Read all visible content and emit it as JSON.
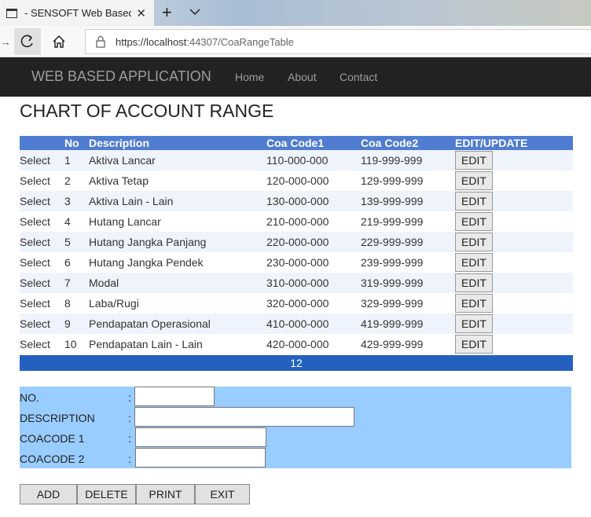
{
  "browser": {
    "tab_title": "- SENSOFT Web Based A",
    "tab_close": "✕",
    "new_tab": "+",
    "url_host": "https://localhost",
    "url_rest": ":44307/CoaRangeTable"
  },
  "navbar": {
    "brand": "WEB BASED APPLICATION",
    "links": [
      "Home",
      "About",
      "Contact"
    ]
  },
  "page": {
    "title": "CHART OF ACCOUNT RANGE"
  },
  "table": {
    "headers": [
      "",
      "No",
      "Description",
      "Coa Code1",
      "Coa Code2",
      "EDIT/UPDATE"
    ],
    "rows": [
      {
        "select": "Select",
        "no": "1",
        "description": "Aktiva Lancar",
        "code1": "110-000-000",
        "code2": "119-999-999",
        "edit": "EDIT"
      },
      {
        "select": "Select",
        "no": "2",
        "description": "Aktiva Tetap",
        "code1": "120-000-000",
        "code2": "129-999-999",
        "edit": "EDIT"
      },
      {
        "select": "Select",
        "no": "3",
        "description": "Aktiva Lain - Lain",
        "code1": "130-000-000",
        "code2": "139-999-999",
        "edit": "EDIT"
      },
      {
        "select": "Select",
        "no": "4",
        "description": "Hutang Lancar",
        "code1": "210-000-000",
        "code2": "219-999-999",
        "edit": "EDIT"
      },
      {
        "select": "Select",
        "no": "5",
        "description": "Hutang Jangka Panjang",
        "code1": "220-000-000",
        "code2": "229-999-999",
        "edit": "EDIT"
      },
      {
        "select": "Select",
        "no": "6",
        "description": "Hutang Jangka Pendek",
        "code1": "230-000-000",
        "code2": "239-999-999",
        "edit": "EDIT"
      },
      {
        "select": "Select",
        "no": "7",
        "description": "Modal",
        "code1": "310-000-000",
        "code2": "319-999-999",
        "edit": "EDIT"
      },
      {
        "select": "Select",
        "no": "8",
        "description": "Laba/Rugi",
        "code1": "320-000-000",
        "code2": "329-999-999",
        "edit": "EDIT"
      },
      {
        "select": "Select",
        "no": "9",
        "description": "Pendapatan Operasional",
        "code1": "410-000-000",
        "code2": "419-999-999",
        "edit": "EDIT"
      },
      {
        "select": "Select",
        "no": "10",
        "description": "Pendapatan Lain - Lain",
        "code1": "420-000-000",
        "code2": "429-999-999",
        "edit": "EDIT"
      }
    ],
    "pager": "12"
  },
  "form": {
    "colon": ":",
    "fields": [
      {
        "label": "NO.",
        "value": ""
      },
      {
        "label": "DESCRIPTION",
        "value": ""
      },
      {
        "label": "COACODE 1",
        "value": ""
      },
      {
        "label": "COACODE 2",
        "value": ""
      }
    ]
  },
  "actions": {
    "add": "ADD",
    "delete": "DELETE",
    "print": "PRINT",
    "exit": "EXIT"
  },
  "colors": {
    "navbar": "#222222",
    "header": "#507cd1",
    "row_alt": "#eff3fb",
    "pager": "#2461bf",
    "form_panel": "#99ccff"
  }
}
